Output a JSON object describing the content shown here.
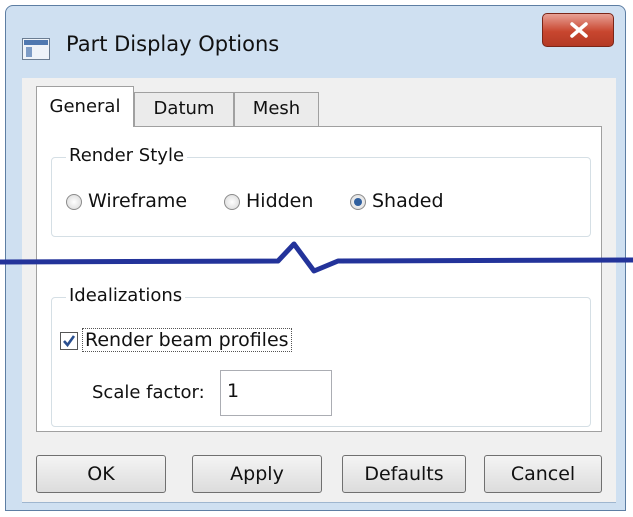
{
  "window": {
    "title": "Part Display Options"
  },
  "tabs": [
    {
      "label": "General",
      "active": true
    },
    {
      "label": "Datum",
      "active": false
    },
    {
      "label": "Mesh",
      "active": false
    }
  ],
  "render_style": {
    "legend": "Render Style",
    "options": [
      {
        "label": "Wireframe",
        "selected": false
      },
      {
        "label": "Hidden",
        "selected": false
      },
      {
        "label": "Shaded",
        "selected": true
      }
    ]
  },
  "idealizations": {
    "legend": "Idealizations",
    "render_beam_profiles": {
      "label": "Render beam profiles",
      "checked": true
    },
    "scale_factor": {
      "label": "Scale factor:",
      "value": "1"
    }
  },
  "buttons": {
    "ok": "OK",
    "apply": "Apply",
    "defaults": "Defaults",
    "cancel": "Cancel"
  },
  "colors": {
    "break_line": "#23339a",
    "close_button": "#c8462f",
    "title_bar": "#cfe0f1"
  }
}
